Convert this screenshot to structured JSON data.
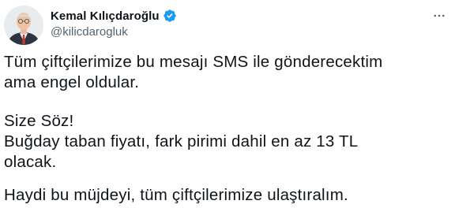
{
  "author": {
    "display_name": "Kemal Kılıçdaroğlu",
    "handle": "@kilicdarogluk",
    "verified": true,
    "avatar_icon": "profile-photo-avatar",
    "verified_icon": "verified-badge-icon"
  },
  "menu": {
    "icon": "more-options-icon"
  },
  "tweet": {
    "paragraph_1": "Tüm çiftçilerimize bu mesajı SMS ile gönderecektim\nama engel oldular.",
    "paragraph_2": "Size Söz!\nBuğday taban fiyatı, fark pirimi dahil en az 13 TL\nolacak.",
    "paragraph_3": "Haydi bu müjdeyi, tüm çiftçilerimize ulaştıralım."
  },
  "colors": {
    "text": "#0f1419",
    "secondary": "#536471",
    "verified": "#1d9bf0",
    "background": "#ffffff"
  }
}
